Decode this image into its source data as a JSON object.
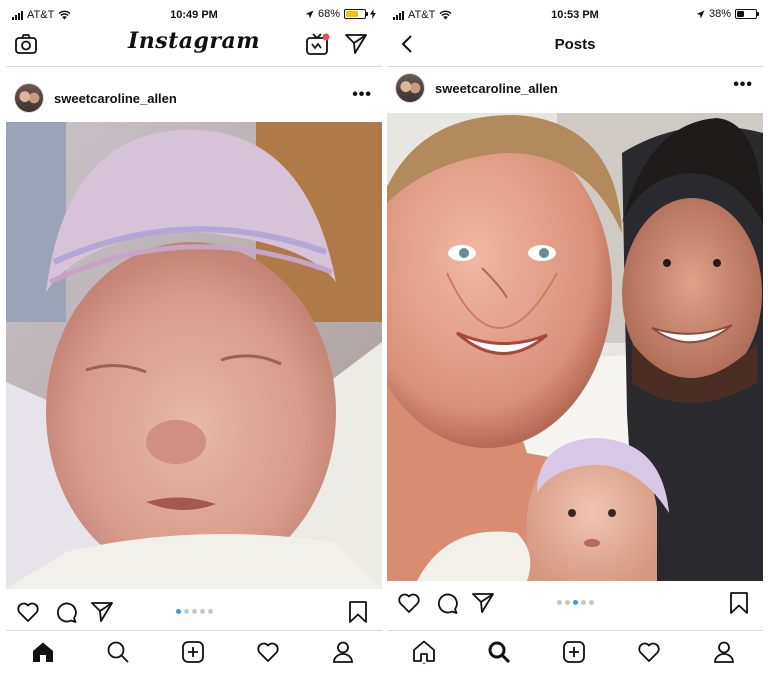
{
  "left": {
    "status": {
      "carrier": "AT&T",
      "time": "10:49 PM",
      "battery": "68%",
      "battery_level": 0.68,
      "battery_color": "#f5c400"
    },
    "header": {
      "logo": "Instagram"
    },
    "post": {
      "username": "sweetcaroline_allen",
      "more": "•••",
      "carousel_pages": 5,
      "carousel_active": 0,
      "photo_icon": "newborn-sleeping-photo"
    }
  },
  "right": {
    "status": {
      "carrier": "AT&T",
      "time": "10:53 PM",
      "battery": "38%",
      "battery_level": 0.38,
      "battery_color": "#111111"
    },
    "header": {
      "title": "Posts"
    },
    "post": {
      "username": "sweetcaroline_allen",
      "more": "•••",
      "carousel_pages": 5,
      "carousel_active": 2,
      "photo_icon": "family-selfie-photo"
    }
  },
  "colors": {
    "accent": "#3897f0",
    "notification": "#ed4956",
    "divider": "#dbdbdb"
  }
}
